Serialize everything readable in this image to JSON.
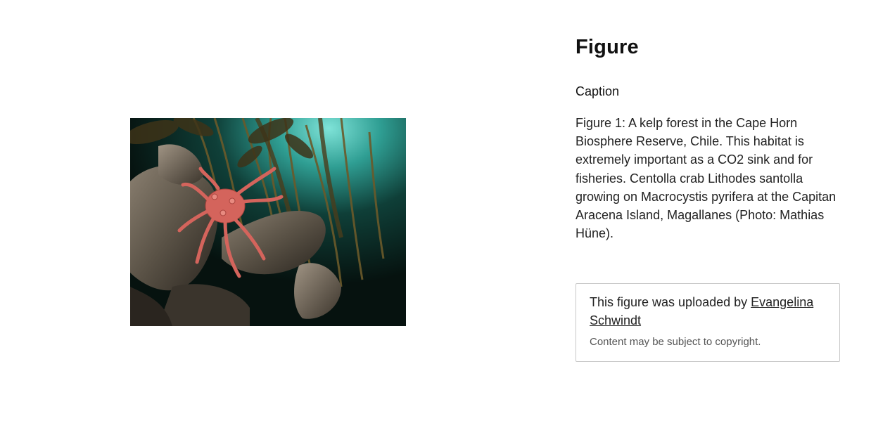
{
  "figure": {
    "heading": "Figure",
    "caption_label": "Caption",
    "caption_text": "Figure 1: A kelp forest in the Cape Horn Biosphere Reserve, Chile. This habitat is extremely important as a CO2 sink and for fisheries. Centolla crab Lithodes santolla growing on Macrocystis pyrifera at the Capitan Aracena Island, Magallanes (Photo: Mathias Hüne).",
    "image_icon": "underwater-kelp-crab-photo"
  },
  "upload": {
    "prefix": "This figure was uploaded by ",
    "author": "Evangelina Schwindt",
    "copyright_note": "Content may be subject to copyright."
  }
}
